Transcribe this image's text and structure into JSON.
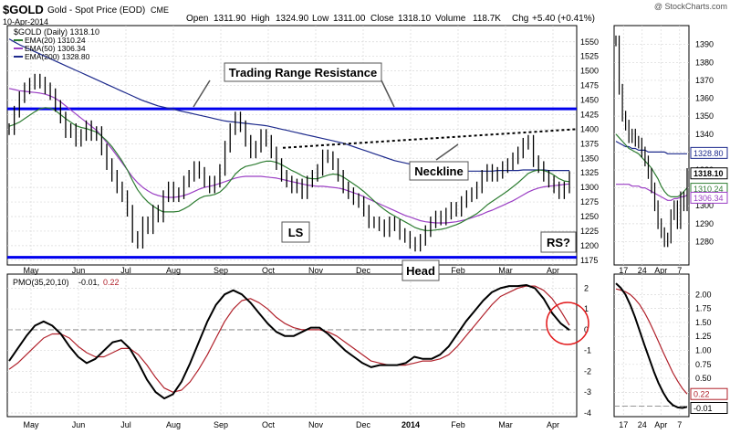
{
  "header": {
    "symbol": "$GOLD",
    "description": "Gold - Spot Price (EOD)",
    "exchange": "CME",
    "date": "10-Apr-2014",
    "watermark": "@ StockCharts.com",
    "open_label": "Open",
    "open": "1311.90",
    "high_label": "High",
    "high": "1324.90",
    "low_label": "Low",
    "low": "1311.00",
    "close_label": "Close",
    "close": "1318.10",
    "volume_label": "Volume",
    "volume": "118.7K",
    "chg_label": "Chg",
    "chg": "+5.40 (+0.41%)"
  },
  "legend": {
    "price": "$GOLD (Daily) 1318.10",
    "ema20": "EMA(20) 1310.24",
    "ema50": "EMA(50) 1306.34",
    "ema200": "EMA(200) 1328.80"
  },
  "colors": {
    "price": "#000000",
    "ema20": "#2e7d32",
    "ema50": "#9b3fc4",
    "ema200": "#1d2a8c",
    "resistance": "#0000ee",
    "pmo": "#000000",
    "pmo_signal": "#b0202a",
    "circle": "#e2191b",
    "grid": "#d8d8d8"
  },
  "annotations": {
    "trading_range": "Trading Range Resistance",
    "neckline": "Neckline",
    "ls": "LS",
    "head": "Head",
    "rs": "RS?"
  },
  "pmo_legend": {
    "label": "PMO(35,20,10)",
    "value": "-0.01,",
    "signal": "0.22"
  },
  "right_labels": {
    "close": "1318.10",
    "ema200": "1328.80",
    "ema20": "1310.24",
    "ema50": "1306.34",
    "pmo_signal": "0.22",
    "pmo": "-0.01"
  },
  "chart_data": {
    "type": "line",
    "main": {
      "ylim": [
        1170,
        1570
      ],
      "yticks": [
        "1175",
        "1200",
        "1225",
        "1250",
        "1275",
        "1300",
        "1325",
        "1350",
        "1375",
        "1400",
        "1425",
        "1450",
        "1475",
        "1500",
        "1525",
        "1550"
      ],
      "xticks": [
        "May",
        "Jun",
        "Jul",
        "Aug",
        "Sep",
        "Oct",
        "Nov",
        "Dec",
        "2014",
        "Feb",
        "Mar",
        "Apr"
      ],
      "resistance_level": 1435,
      "support_level": 1180,
      "neckline": [
        {
          "date": "Oct 2013",
          "price": 1368
        },
        {
          "date": "Apr 2014",
          "price": 1400
        }
      ],
      "price": [
        1400,
        1430,
        1455,
        1470,
        1478,
        1485,
        1480,
        1470,
        1460,
        1440,
        1420,
        1395,
        1400,
        1380,
        1390,
        1405,
        1390,
        1395,
        1365,
        1340,
        1320,
        1300,
        1285,
        1260,
        1215,
        1205,
        1240,
        1230,
        1260,
        1250,
        1285,
        1300,
        1285,
        1290,
        1310,
        1320,
        1335,
        1325,
        1310,
        1300,
        1310,
        1330,
        1370,
        1400,
        1420,
        1405,
        1380,
        1360,
        1370,
        1390,
        1380,
        1360,
        1340,
        1320,
        1310,
        1300,
        1305,
        1290,
        1310,
        1320,
        1330,
        1355,
        1352,
        1340,
        1320,
        1300,
        1290,
        1280,
        1275,
        1260,
        1240,
        1240,
        1235,
        1225,
        1240,
        1235,
        1220,
        1215,
        1205,
        1200,
        1210,
        1225,
        1240,
        1250,
        1245,
        1255,
        1265,
        1260,
        1275,
        1285,
        1290,
        1300,
        1320,
        1330,
        1320,
        1325,
        1335,
        1340,
        1350,
        1360,
        1375,
        1380,
        1345,
        1335,
        1320,
        1310,
        1300,
        1290,
        1300,
        1318
      ],
      "ema20": [
        1405,
        1408,
        1412,
        1418,
        1424,
        1430,
        1435,
        1437,
        1436,
        1432,
        1425,
        1418,
        1412,
        1406,
        1403,
        1401,
        1398,
        1395,
        1388,
        1380,
        1370,
        1358,
        1345,
        1330,
        1312,
        1296,
        1284,
        1275,
        1268,
        1262,
        1258,
        1258,
        1258,
        1259,
        1263,
        1268,
        1275,
        1281,
        1285,
        1286,
        1288,
        1292,
        1300,
        1311,
        1323,
        1331,
        1336,
        1338,
        1340,
        1343,
        1345,
        1345,
        1343,
        1339,
        1334,
        1329,
        1325,
        1320,
        1316,
        1315,
        1315,
        1318,
        1321,
        1323,
        1322,
        1318,
        1312,
        1306,
        1300,
        1293,
        1285,
        1277,
        1269,
        1262,
        1256,
        1251,
        1246,
        1241,
        1236,
        1231,
        1228,
        1226,
        1226,
        1227,
        1228,
        1230,
        1233,
        1236,
        1240,
        1245,
        1250,
        1255,
        1262,
        1270,
        1276,
        1282,
        1288,
        1294,
        1301,
        1308,
        1316,
        1324,
        1328,
        1330,
        1329,
        1326,
        1321,
        1315,
        1311,
        1310
      ],
      "ema50": [
        1470,
        1468,
        1466,
        1465,
        1464,
        1463,
        1462,
        1460,
        1457,
        1453,
        1447,
        1440,
        1433,
        1426,
        1419,
        1412,
        1405,
        1398,
        1388,
        1377,
        1366,
        1354,
        1342,
        1330,
        1318,
        1308,
        1300,
        1294,
        1289,
        1286,
        1284,
        1283,
        1283,
        1284,
        1286,
        1289,
        1293,
        1297,
        1300,
        1302,
        1304,
        1307,
        1310,
        1313,
        1316,
        1318,
        1319,
        1319,
        1319,
        1319,
        1318,
        1317,
        1316,
        1314,
        1312,
        1310,
        1308,
        1306,
        1304,
        1303,
        1302,
        1302,
        1301,
        1300,
        1299,
        1297,
        1294,
        1291,
        1288,
        1284,
        1280,
        1276,
        1272,
        1268,
        1264,
        1260,
        1256,
        1252,
        1249,
        1246,
        1243,
        1241,
        1240,
        1239,
        1239,
        1239,
        1240,
        1241,
        1243,
        1245,
        1248,
        1251,
        1254,
        1258,
        1261,
        1265,
        1269,
        1273,
        1277,
        1282,
        1287,
        1292,
        1296,
        1299,
        1301,
        1302,
        1303,
        1304,
        1305,
        1306
      ],
      "ema200": [
        1555,
        1550,
        1545,
        1541,
        1537,
        1533,
        1529,
        1525,
        1521,
        1517,
        1513,
        1509,
        1505,
        1501,
        1497,
        1493,
        1489,
        1485,
        1481,
        1477,
        1473,
        1469,
        1465,
        1461,
        1457,
        1453,
        1449,
        1446,
        1443,
        1440,
        1438,
        1436,
        1434,
        1432,
        1430,
        1428,
        1426,
        1424,
        1422,
        1420,
        1418,
        1416,
        1414,
        1413,
        1412,
        1411,
        1410,
        1409,
        1408,
        1407,
        1406,
        1404,
        1402,
        1400,
        1398,
        1396,
        1394,
        1392,
        1390,
        1388,
        1386,
        1384,
        1382,
        1380,
        1378,
        1376,
        1373,
        1370,
        1367,
        1364,
        1361,
        1358,
        1355,
        1352,
        1349,
        1346,
        1344,
        1342,
        1340,
        1338,
        1336,
        1334,
        1333,
        1332,
        1331,
        1330,
        1329,
        1329,
        1328,
        1328,
        1328,
        1328,
        1328,
        1328,
        1328,
        1329,
        1329,
        1329,
        1329,
        1329,
        1330,
        1330,
        1330,
        1330,
        1330,
        1329,
        1329,
        1329,
        1329,
        1329
      ]
    },
    "pmo": {
      "ylim": [
        -4,
        2.5
      ],
      "yticks": [
        "-4",
        "-3",
        "-2",
        "-1",
        "0",
        "1",
        "2"
      ],
      "xticks": [
        "May",
        "Jun",
        "Jul",
        "Aug",
        "Sep",
        "Oct",
        "Nov",
        "Dec",
        "2014",
        "Feb",
        "Mar",
        "Apr"
      ],
      "pmo": [
        -1.5,
        -0.9,
        -0.3,
        0.2,
        0.4,
        0.2,
        -0.2,
        -0.8,
        -1.3,
        -1.6,
        -1.4,
        -1.0,
        -0.6,
        -0.5,
        -0.9,
        -1.6,
        -2.4,
        -3.0,
        -3.3,
        -3.1,
        -2.5,
        -1.6,
        -0.6,
        0.4,
        1.2,
        1.7,
        1.9,
        1.7,
        1.3,
        0.8,
        0.3,
        -0.1,
        -0.3,
        -0.3,
        -0.1,
        0.1,
        0.1,
        -0.2,
        -0.6,
        -1.0,
        -1.3,
        -1.6,
        -1.8,
        -1.7,
        -1.7,
        -1.7,
        -1.6,
        -1.3,
        -1.4,
        -1.4,
        -1.2,
        -0.8,
        -0.2,
        0.4,
        0.9,
        1.4,
        1.8,
        2.0,
        2.1,
        2.1,
        2.15,
        2.0,
        1.5,
        0.8,
        0.3,
        -0.01
      ],
      "signal": [
        -1.9,
        -1.6,
        -1.2,
        -0.8,
        -0.4,
        -0.2,
        -0.2,
        -0.4,
        -0.8,
        -1.1,
        -1.3,
        -1.3,
        -1.1,
        -0.9,
        -0.9,
        -1.2,
        -1.7,
        -2.3,
        -2.8,
        -3.0,
        -2.9,
        -2.5,
        -1.9,
        -1.2,
        -0.4,
        0.4,
        1.0,
        1.4,
        1.5,
        1.3,
        1.0,
        0.6,
        0.3,
        0.1,
        0.0,
        0.0,
        0.0,
        -0.1,
        -0.3,
        -0.6,
        -0.9,
        -1.2,
        -1.5,
        -1.6,
        -1.7,
        -1.7,
        -1.7,
        -1.6,
        -1.5,
        -1.5,
        -1.4,
        -1.2,
        -0.8,
        -0.3,
        0.2,
        0.7,
        1.2,
        1.6,
        1.8,
        2.0,
        2.1,
        2.1,
        1.9,
        1.5,
        0.9,
        0.22
      ]
    },
    "zoom_main": {
      "ylim": [
        1268,
        1398
      ],
      "yticks": [
        "1280",
        "1290",
        "1300",
        "1310",
        "1320",
        "1330",
        "1340",
        "1350",
        "1360",
        "1370",
        "1380",
        "1390"
      ],
      "xticks": [
        "17",
        "24",
        "Apr",
        "7"
      ],
      "price": [
        1392,
        1365,
        1350,
        1345,
        1338,
        1340,
        1336,
        1335,
        1330,
        1325,
        1318,
        1310,
        1300,
        1290,
        1285,
        1280,
        1282,
        1295,
        1300,
        1290,
        1305,
        1300,
        1318
      ],
      "ema20": [
        1340,
        1338,
        1336,
        1334,
        1332,
        1331,
        1330,
        1329,
        1327,
        1325,
        1323,
        1321,
        1318,
        1315,
        1311,
        1308,
        1306,
        1305,
        1305,
        1305,
        1306,
        1308,
        1310
      ],
      "ema50": [
        1312,
        1312,
        1312,
        1312,
        1312,
        1311,
        1311,
        1311,
        1310,
        1310,
        1309,
        1308,
        1307,
        1306,
        1305,
        1304,
        1303,
        1303,
        1304,
        1304,
        1305,
        1305,
        1306
      ],
      "ema200": [
        1336,
        1335,
        1334,
        1333,
        1333,
        1332,
        1332,
        1331,
        1331,
        1331,
        1330,
        1330,
        1330,
        1330,
        1330,
        1330,
        1329,
        1329,
        1329,
        1329,
        1329,
        1329,
        1329
      ]
    },
    "zoom_pmo": {
      "ylim": [
        -0.12,
        2.3
      ],
      "yticks": [
        "0.00",
        "0.25",
        "0.50",
        "0.75",
        "1.00",
        "1.25",
        "1.50",
        "1.75",
        "2.00"
      ],
      "xticks": [
        "17",
        "24",
        "Apr",
        "7"
      ],
      "pmo": [
        2.2,
        2.12,
        2.0,
        1.82,
        1.6,
        1.35,
        1.1,
        0.86,
        0.62,
        0.41,
        0.24,
        0.1,
        0.02,
        -0.02,
        -0.03,
        -0.01
      ],
      "signal": [
        2.1,
        2.08,
        2.05,
        2.0,
        1.92,
        1.82,
        1.68,
        1.52,
        1.34,
        1.15,
        0.96,
        0.78,
        0.6,
        0.45,
        0.32,
        0.22
      ]
    }
  }
}
